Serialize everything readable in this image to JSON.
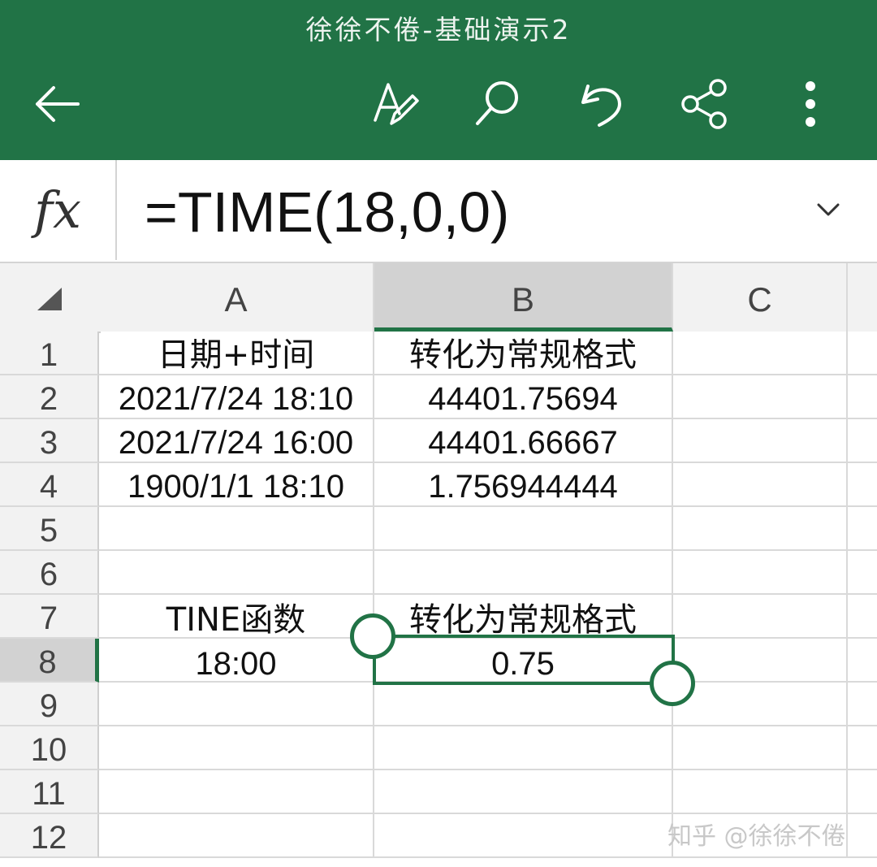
{
  "title": "徐徐不倦-基础演示2",
  "toolbar": {
    "back_icon": "arrow-left-icon",
    "format_icon": "text-pen-icon",
    "search_icon": "search-icon",
    "undo_icon": "undo-icon",
    "share_icon": "share-icon",
    "more_icon": "more-vertical-icon"
  },
  "formula_bar": {
    "fx_label": "fx",
    "formula": "=TIME(18,0,0)"
  },
  "columns": [
    "A",
    "B",
    "C"
  ],
  "rows": [
    "1",
    "2",
    "3",
    "4",
    "5",
    "6",
    "7",
    "8",
    "9",
    "10",
    "11",
    "12"
  ],
  "cells": {
    "A1": "日期+时间",
    "B1": "转化为常规格式",
    "A2": "2021/7/24 18:10",
    "B2": "44401.75694",
    "A3": "2021/7/24 16:00",
    "B3": "44401.66667",
    "A4": "1900/1/1 18:10",
    "B4": "1.756944444",
    "A7": "TINE函数",
    "B7": "转化为常规格式",
    "A8": "18:00",
    "B8": "0.75"
  },
  "selection": {
    "active_column": "B",
    "active_row": "8",
    "cell": "B8"
  },
  "watermark": "知乎 @徐徐不倦",
  "colors": {
    "accent": "#217346",
    "header_bg": "#f2f2f2",
    "grid": "#d9d9d9"
  }
}
